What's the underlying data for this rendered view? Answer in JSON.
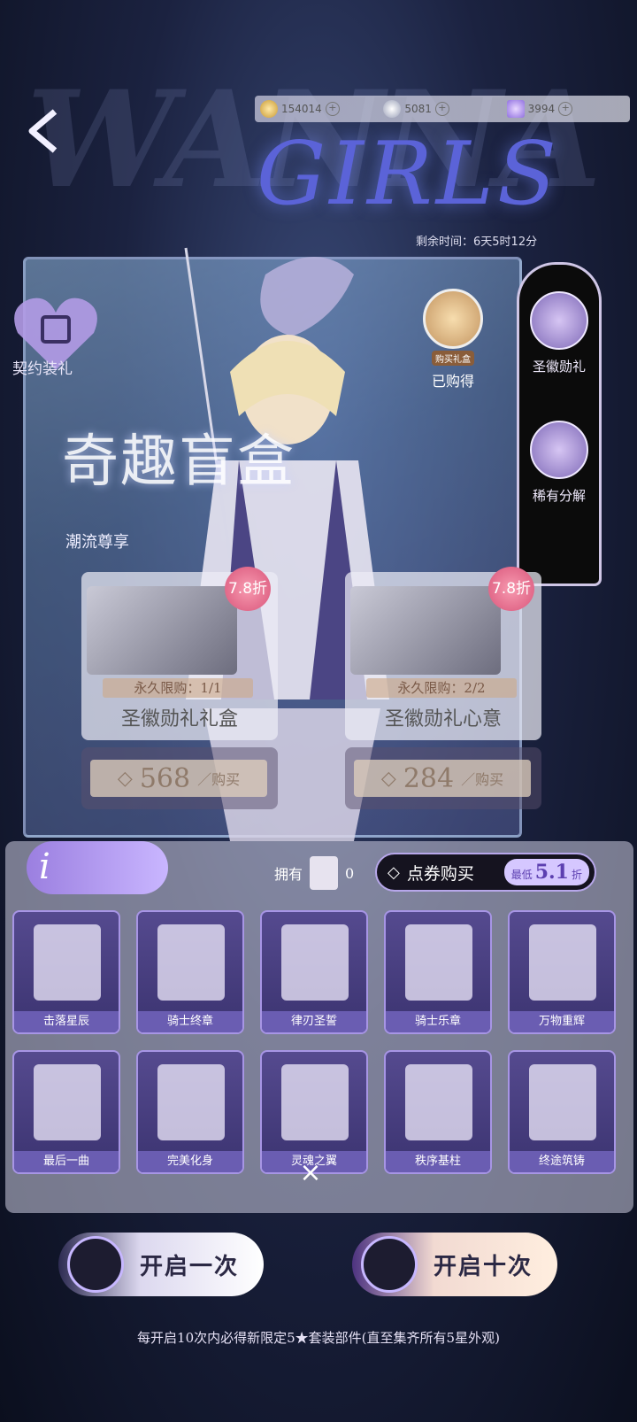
{
  "topbar": {
    "currencies": [
      {
        "icon": "gold-coin-icon",
        "value": "154014"
      },
      {
        "icon": "paw-coin-icon",
        "value": "5081"
      },
      {
        "icon": "diamond-icon",
        "value": "3994"
      }
    ],
    "bg_logo": "WANNA",
    "title": "GIRLS",
    "timer": "剩余时间：6天5时12分"
  },
  "panel": {
    "lock_label": "契约装礼",
    "have_tag": "购买礼盒",
    "have_label": "已购得",
    "promo_title": "奇趣盲盒",
    "promo_tag": "潮流尊享"
  },
  "sidebar": {
    "items": [
      {
        "label": "圣徽勋礼",
        "icon": "badge-icon"
      },
      {
        "label": "稀有分解",
        "icon": "decompose-icon"
      }
    ]
  },
  "cards": [
    {
      "name": "圣徽勋礼礼盒",
      "discount": "7.8折",
      "limit": "永久限购：1/1",
      "price": "568",
      "unit": "／购买"
    },
    {
      "name": "圣徽勋礼心意",
      "discount": "7.8折",
      "limit": "永久限购：2/2",
      "price": "284",
      "unit": "／购买"
    }
  ],
  "lower": {
    "own_label": "拥有",
    "own_count": "0",
    "buy_label": "点券购买",
    "lowest_prefix": "最低",
    "lowest_value": "5.1",
    "lowest_suffix": "折"
  },
  "items": [
    {
      "label": "击落星辰"
    },
    {
      "label": "骑士终章"
    },
    {
      "label": "律刃圣誓"
    },
    {
      "label": "骑士乐章"
    },
    {
      "label": "万物重辉"
    },
    {
      "label": "最后一曲"
    },
    {
      "label": "完美化身"
    },
    {
      "label": "灵魂之翼"
    },
    {
      "label": "秩序基柱"
    },
    {
      "label": "终途筑铸"
    }
  ],
  "buttons": {
    "draw_once": "开启一次",
    "draw_ten": "开启十次"
  },
  "footer": "每开启10次内必得新限定5★套装部件(直至集齐所有5星外观)"
}
